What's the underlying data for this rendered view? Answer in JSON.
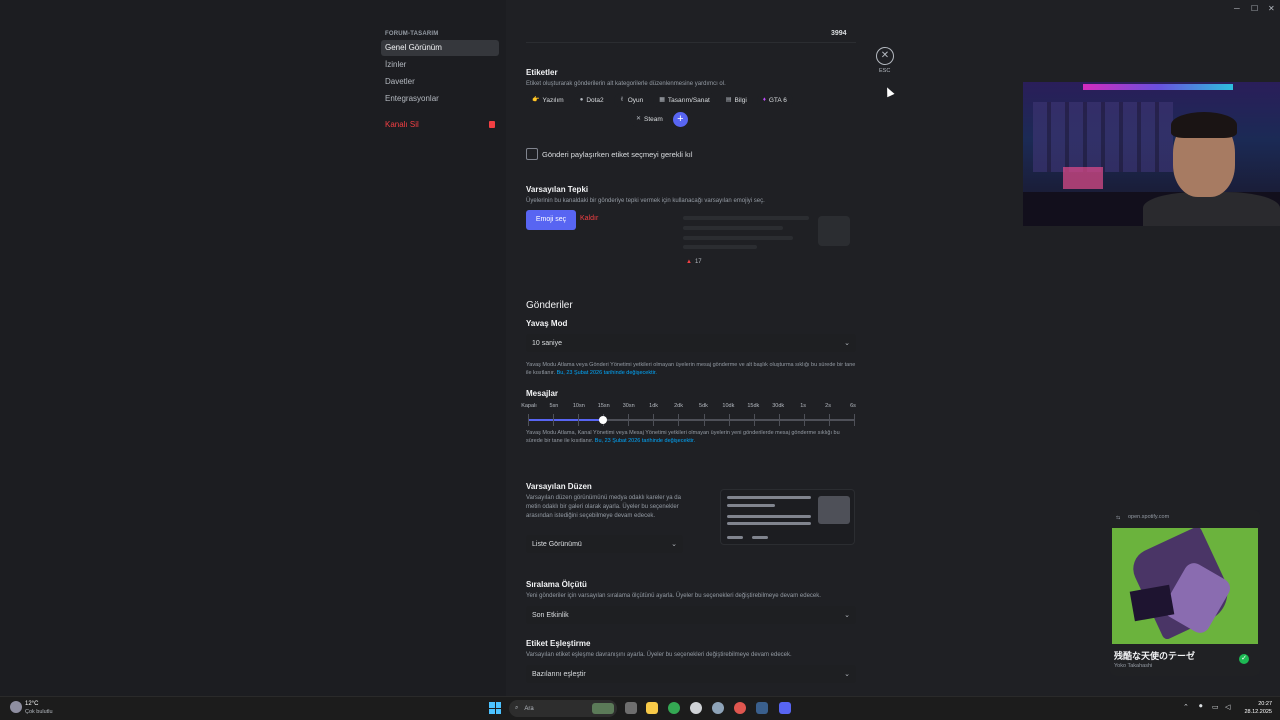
{
  "sidebar": {
    "header": "FORUM-TASARIM",
    "items": [
      "Genel Görünüm",
      "İzinler",
      "Davetler",
      "Entegrasyonlar"
    ],
    "danger_label": "Kanalı Sil"
  },
  "top_number": "3994",
  "close": {
    "esc_label": "ESC"
  },
  "tags_section": {
    "title": "Etiketler",
    "description": "Etiket oluşturarak gönderilerin alt kategorilerle düzenlenmesine yardımcı ol.",
    "tags": [
      {
        "icon": "👉",
        "label": "Yazılım"
      },
      {
        "icon": "●",
        "label": "Dota2"
      },
      {
        "icon": "✌",
        "label": "Oyun"
      },
      {
        "icon": "▦",
        "label": "Tasarım/Sanat"
      },
      {
        "icon": "▤",
        "label": "Bilgi"
      },
      {
        "icon": "♦",
        "label": "GTA 6"
      },
      {
        "icon": "✕",
        "label": "Steam"
      }
    ],
    "add_label": "+"
  },
  "require_tag": {
    "label": "Gönderi paylaşırken etiket seçmeyi gerekli kıl"
  },
  "default_reaction": {
    "title": "Varsayılan Tepki",
    "description": "Üyelerinin bu kanaldaki bir gönderiye tepki vermek için kullanacağı varsayılan emojiyi seç.",
    "choose_label": "Emoji seç",
    "remove_label": "Kaldır",
    "preview_count": "17"
  },
  "posts": {
    "title": "Gönderiler",
    "slow_mode_title": "Yavaş Mod",
    "slow_mode_value": "10 saniye",
    "slow_mode_note": "Yavaş Modu Atlama veya Gönderi Yönetimi yetkileri olmayan üyelerin mesaj gönderme ve alt başlık oluşturma sıklığı bu sürede bir tane ile kısıtlanır.",
    "slow_mode_note_link": "Bu, 23 Şubat 2026 tarihinde değişecektir.",
    "messages_title": "Mesajlar",
    "slider_labels": [
      "Kapalı",
      "5sn",
      "10sn",
      "15sn",
      "30sn",
      "1dk",
      "2dk",
      "5dk",
      "10dk",
      "15dk",
      "30dk",
      "1s",
      "2s",
      "6s"
    ],
    "slider_selected": "15sn",
    "messages_note": "Yavaş Modu Atlama, Kanal Yönetimi veya Mesaj Yönetimi yetkileri olmayan üyelerin yeni gönderilerde mesaj gönderme sıklığı bu sürede bir tane ile kısıtlanır.",
    "messages_note_link": "Bu, 23 Şubat 2026 tarihinde değişecektir."
  },
  "default_layout": {
    "title": "Varsayılan Düzen",
    "description": "Varsayılan düzen görünümünü medya odaklı kareler ya da metin odaklı bir galeri olarak ayarla. Üyeler bu seçenekler arasından istediğini seçebilmeye devam edecek.",
    "value": "Liste Görünümü"
  },
  "sort_order": {
    "title": "Sıralama Ölçütü",
    "description": "Yeni gönderiler için varsayılan sıralama ölçütünü ayarla. Üyeler bu seçenekleri değiştirebilmeye devam edecek.",
    "value": "Son Etkinlik"
  },
  "tag_matching": {
    "title": "Etiket Eşleştirme",
    "description": "Varsayılan etiket eşleşme davranışını ayarla. Üyeler bu seçenekleri değiştirebilmeye devam edecek.",
    "value": "Bazılarını eşleştir"
  },
  "spotify": {
    "source": "open.spotify.com",
    "title": "残酷な天使のテーゼ",
    "artist": "Yoko Takahashi"
  },
  "taskbar": {
    "temp": "12°C",
    "weather": "Çok bulutlu",
    "search_placeholder": "Ara",
    "time": "20:27",
    "date": "28.12.2025"
  },
  "colors": {
    "accent": "#5865f2",
    "danger": "#f23f43",
    "link": "#00a8fc"
  }
}
